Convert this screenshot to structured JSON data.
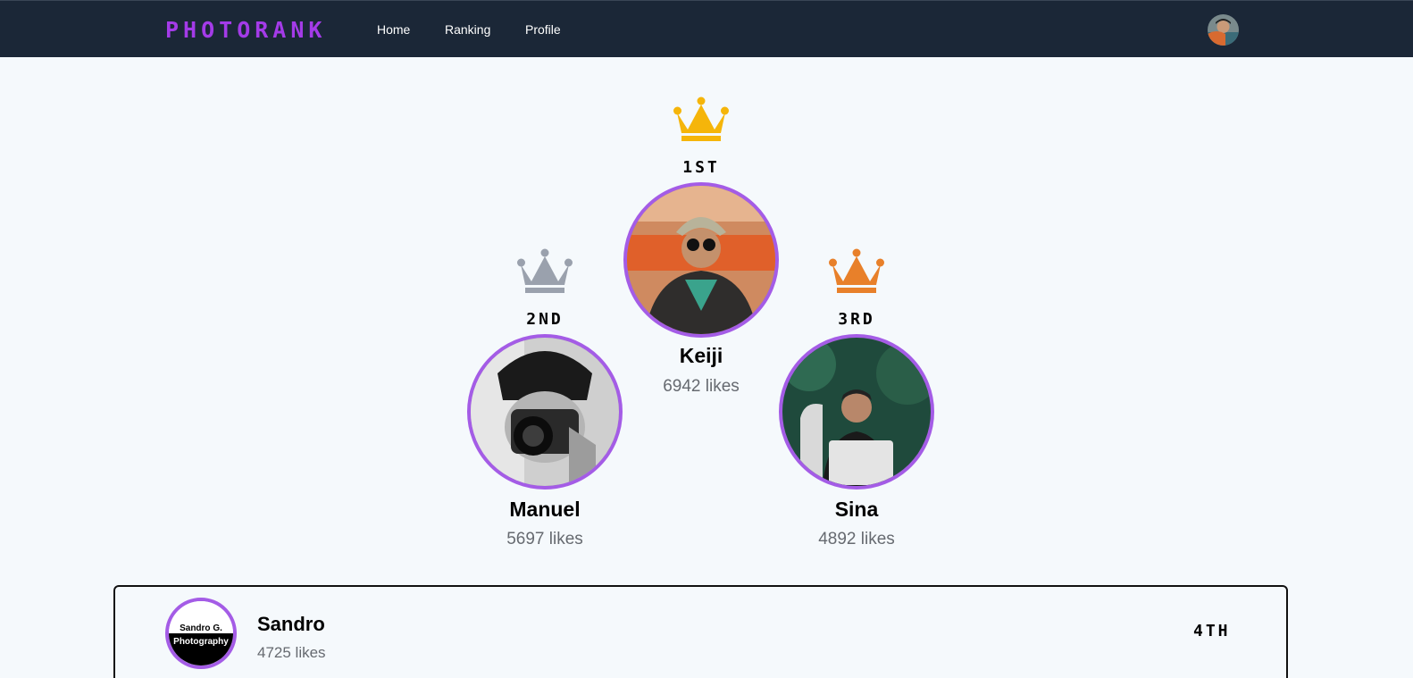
{
  "nav": {
    "logo": "PHOTORANK",
    "links": [
      {
        "label": "Home"
      },
      {
        "label": "Ranking"
      },
      {
        "label": "Profile"
      }
    ]
  },
  "podium": [
    {
      "rank": "1ST",
      "name": "Keiji",
      "likes": "6942 likes",
      "crown_color": "#f5b50a"
    },
    {
      "rank": "2ND",
      "name": "Manuel",
      "likes": "5697 likes",
      "crown_color": "#9aa1ad"
    },
    {
      "rank": "3RD",
      "name": "Sina",
      "likes": "4892 likes",
      "crown_color": "#e8802a"
    }
  ],
  "list": [
    {
      "name": "Sandro",
      "likes": "4725 likes",
      "rank": "4TH",
      "avatar_text": [
        "Sandro G.",
        "Photography"
      ]
    }
  ],
  "colors": {
    "accent": "#a43be8",
    "avatar_border": "#a45ce6",
    "navbar": "#1b2737",
    "background": "#f5f9fc"
  }
}
